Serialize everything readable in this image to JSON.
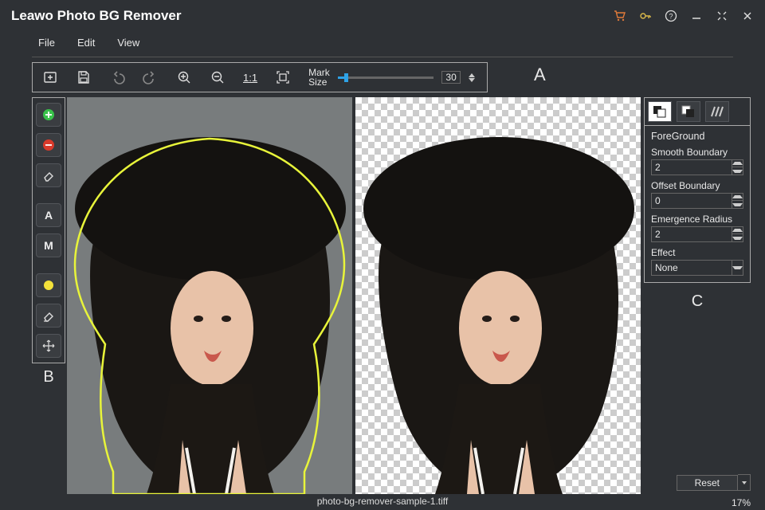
{
  "app": {
    "title": "Leawo Photo BG Remover"
  },
  "menus": {
    "file": "File",
    "edit": "Edit",
    "view": "View"
  },
  "toolbar": {
    "mark_size_label1": "Mark",
    "mark_size_label2": "Size",
    "mark_size_value": "30"
  },
  "annotations": {
    "A": "A",
    "B": "B",
    "C": "C"
  },
  "sidebar": {
    "auto": "A",
    "manual": "M"
  },
  "right_panel": {
    "section": "ForeGround",
    "smooth_label": "Smooth Boundary",
    "smooth_value": "2",
    "offset_label": "Offset Boundary",
    "offset_value": "0",
    "emergence_label": "Emergence Radius",
    "emergence_value": "2",
    "effect_label": "Effect",
    "effect_value": "None"
  },
  "bottom": {
    "filename": "photo-bg-remover-sample-1.tiff",
    "reset": "Reset",
    "zoom": "17%"
  }
}
